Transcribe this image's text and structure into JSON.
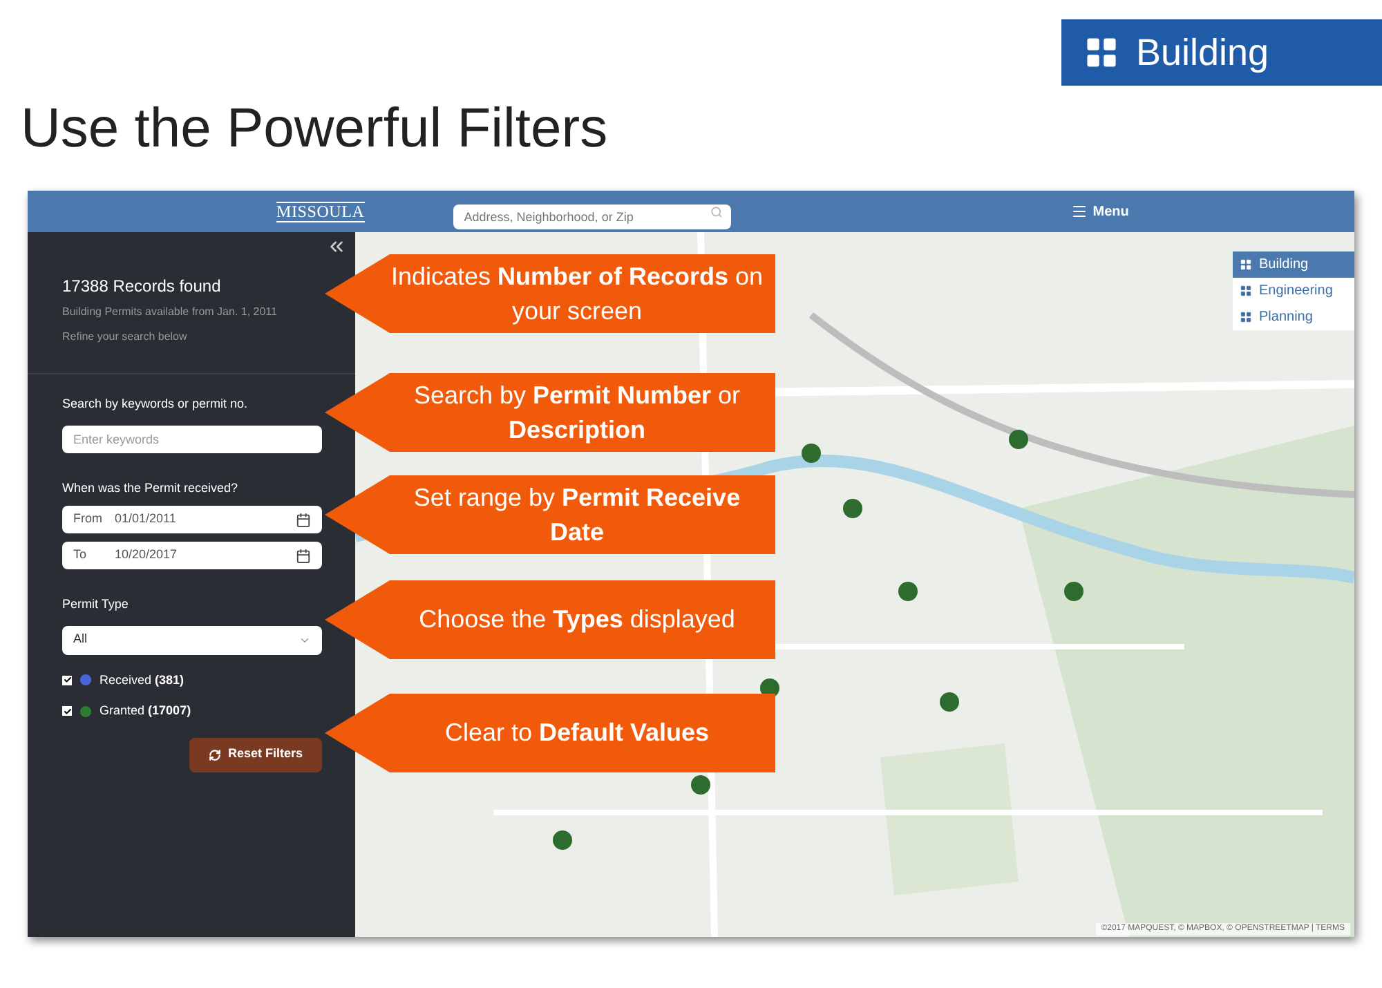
{
  "slide_title": "Use the Powerful Filters",
  "badge": {
    "label": "Building"
  },
  "app": {
    "header": {
      "logo": "MISSOULA",
      "search": {
        "placeholder": "Address, Neighborhood, or Zip"
      },
      "menu": "Menu"
    },
    "sidebar": {
      "records": "17388 Records found",
      "subtitle": "Building Permits available from Jan. 1, 2011",
      "hint": "Refine your search below",
      "keyword_label": "Search by keywords or permit no.",
      "keyword_placeholder": "Enter keywords",
      "date_label": "When was the Permit received?",
      "dates": [
        {
          "label": "From",
          "value": "01/01/2011"
        },
        {
          "label": "To",
          "value": "10/20/2017"
        }
      ],
      "type_label": "Permit Type",
      "type_value": "All",
      "statuses": [
        {
          "label": "Received",
          "count": "(381)",
          "checked": true,
          "color": "#4a64d8"
        },
        {
          "label": "Granted",
          "count": "(17007)",
          "checked": true,
          "color": "#2e7d32"
        }
      ],
      "reset": "Reset Filters"
    },
    "layers": [
      {
        "label": "Building",
        "selected": true
      },
      {
        "label": "Engineering",
        "selected": false
      },
      {
        "label": "Planning",
        "selected": false
      }
    ],
    "attribution": "©2017 MAPQUEST, © MAPBOX, © OPENSTREETMAP | TERMS"
  },
  "callouts": [
    {
      "text": "Indicates **Number of Records** on your screen"
    },
    {
      "text": "Search by **Permit Number** or **Description**"
    },
    {
      "text": "Set range by **Permit Receive Date**"
    },
    {
      "text": "Choose the **Types** displayed"
    },
    {
      "text": "Clear to **Default Values**"
    }
  ]
}
